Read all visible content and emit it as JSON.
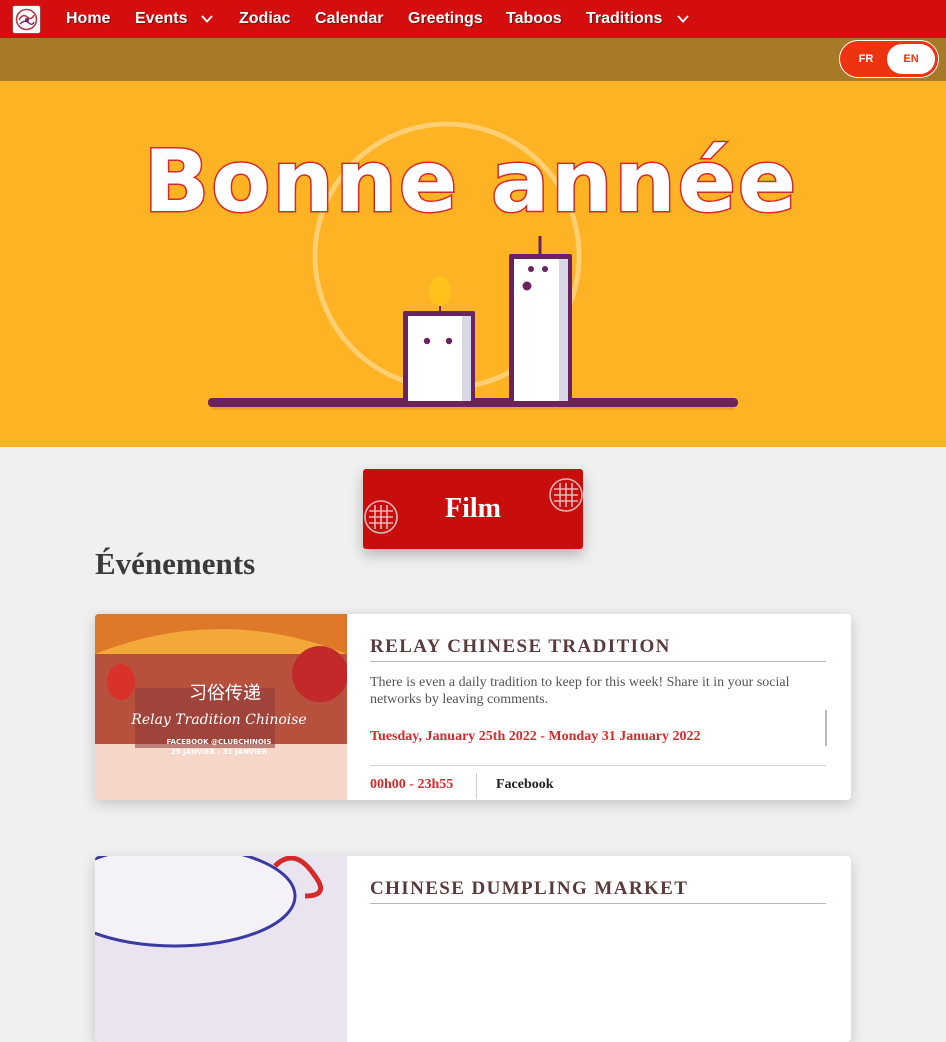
{
  "nav": {
    "logo_icon": "chinese-club-logo-icon",
    "items": [
      {
        "label": "Home",
        "has_dropdown": false
      },
      {
        "label": "Events",
        "has_dropdown": true
      },
      {
        "label": "Zodiac",
        "has_dropdown": false
      },
      {
        "label": "Calendar",
        "has_dropdown": false
      },
      {
        "label": "Greetings",
        "has_dropdown": false
      },
      {
        "label": "Taboos",
        "has_dropdown": false
      },
      {
        "label": "Traditions",
        "has_dropdown": true
      }
    ]
  },
  "language": {
    "options": [
      "FR",
      "EN"
    ],
    "selected": "EN"
  },
  "hero": {
    "title": "Bonne année"
  },
  "film_button": {
    "label": "Film"
  },
  "events_section": {
    "title": "Événements"
  },
  "events": [
    {
      "title": "RELAY CHINESE TRADITION",
      "description": "There is even a daily tradition to keep for this week! Share it in your social networks by leaving comments.",
      "date": "Tuesday, January 25th 2022 - Monday 31 January 2022",
      "time": "00h00 - 23h55",
      "place": "Facebook",
      "image": {
        "chinese_title": "习俗传递",
        "caption": "Relay Tradition Chinoise",
        "line1": "FACEBOOK @CLUBCHINOIS",
        "line2": "25 JANVIER - 31 JANVIER"
      }
    },
    {
      "title": "CHINESE DUMPLING MARKET"
    }
  ],
  "colors": {
    "nav_red": "#d40e0e",
    "subbar_brown": "#a77a28",
    "hero_yellow": "#fdb324",
    "accent_red": "#d42a2a",
    "film_red": "#c80d0d"
  }
}
